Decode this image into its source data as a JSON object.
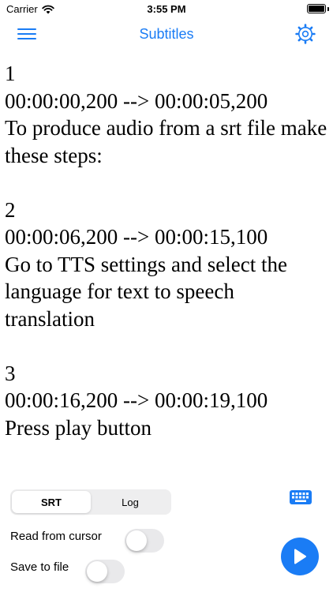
{
  "status_bar": {
    "carrier": "Carrier",
    "time": "3:55 PM"
  },
  "nav": {
    "title": "Subtitles",
    "menu_icon": "hamburger-menu-icon",
    "settings_icon": "gear-icon"
  },
  "editor": {
    "text": "1\n00:00:00,200 --> 00:00:05,200\nTo produce audio from a srt file make these steps:\n\n2\n00:00:06,200 --> 00:00:15,100\nGo to TTS settings and select the language for text to speech translation\n\n3\n00:00:16,200 --> 00:00:19,100\nPress play button"
  },
  "segmented": {
    "options": [
      "SRT",
      "Log"
    ],
    "selected": "SRT"
  },
  "controls": {
    "read_from_cursor_label": "Read from cursor",
    "read_from_cursor_on": false,
    "save_to_file_label": "Save to file",
    "save_to_file_on": false,
    "keyboard_icon": "keyboard-icon",
    "play_icon": "play-icon"
  },
  "colors": {
    "accent": "#1a7cf5",
    "toggle_off": "#e9e9eb",
    "segment_bg": "#eeeeef"
  }
}
